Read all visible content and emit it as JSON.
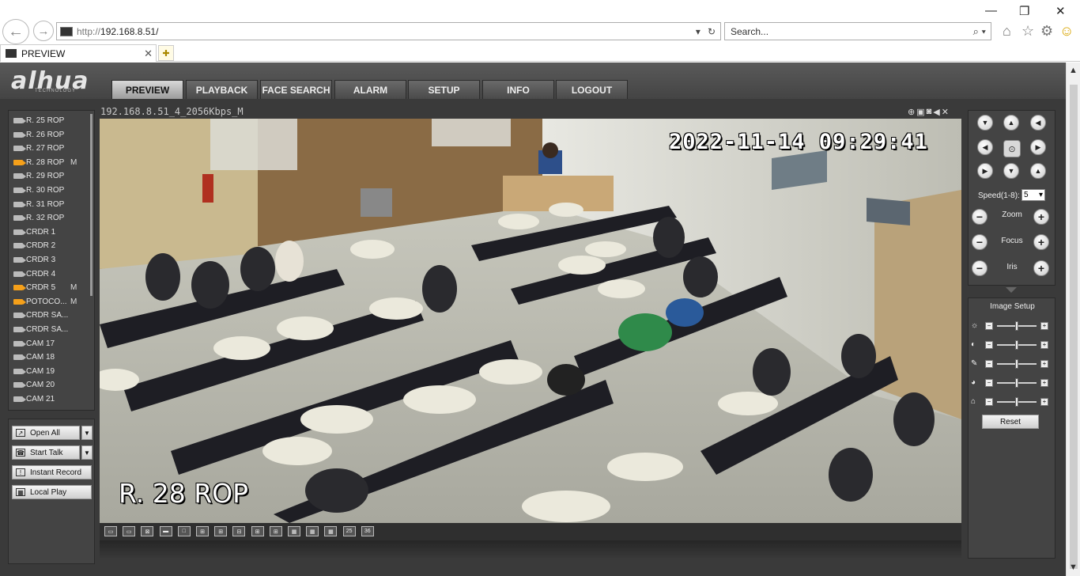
{
  "browser": {
    "url_proto": "http://",
    "url_host": "192.168.8.51/",
    "search_placeholder": "Search...",
    "tab_title": "PREVIEW"
  },
  "app": {
    "logo": "alhua",
    "logo_sub": "TECHNOLOGY",
    "menu": [
      "PREVIEW",
      "PLAYBACK",
      "FACE SEARCH",
      "ALARM",
      "SETUP",
      "INFO",
      "LOGOUT"
    ],
    "active_menu": "PREVIEW"
  },
  "cameras": [
    {
      "label": "R. 25 ROP",
      "active": false,
      "flag": ""
    },
    {
      "label": "R. 26 ROP",
      "active": false,
      "flag": ""
    },
    {
      "label": "R. 27 ROP",
      "active": false,
      "flag": ""
    },
    {
      "label": "R. 28 ROP",
      "active": true,
      "flag": "M"
    },
    {
      "label": "R. 29 ROP",
      "active": false,
      "flag": ""
    },
    {
      "label": "R. 30 ROP",
      "active": false,
      "flag": ""
    },
    {
      "label": "R. 31 ROP",
      "active": false,
      "flag": ""
    },
    {
      "label": "R. 32 ROP",
      "active": false,
      "flag": ""
    },
    {
      "label": "CRDR 1",
      "active": false,
      "flag": ""
    },
    {
      "label": "CRDR 2",
      "active": false,
      "flag": ""
    },
    {
      "label": "CRDR 3",
      "active": false,
      "flag": ""
    },
    {
      "label": "CRDR 4",
      "active": false,
      "flag": ""
    },
    {
      "label": "CRDR 5",
      "active": true,
      "flag": "M"
    },
    {
      "label": "POTOCO...",
      "active": true,
      "flag": "M"
    },
    {
      "label": "CRDR SA...",
      "active": false,
      "flag": ""
    },
    {
      "label": "CRDR SA...",
      "active": false,
      "flag": ""
    },
    {
      "label": "CAM 17",
      "active": false,
      "flag": ""
    },
    {
      "label": "CAM 18",
      "active": false,
      "flag": ""
    },
    {
      "label": "CAM 19",
      "active": false,
      "flag": ""
    },
    {
      "label": "CAM 20",
      "active": false,
      "flag": ""
    },
    {
      "label": "CAM 21",
      "active": false,
      "flag": ""
    }
  ],
  "actions": {
    "open_all": "Open All",
    "start_talk": "Start Talk",
    "instant_record": "Instant Record",
    "local_play": "Local Play"
  },
  "video": {
    "stream_title": "192.168.8.51_4_2056Kbps_M",
    "osd_time": "2022-11-14 09:29:41",
    "osd_name": "R. 28 ROP"
  },
  "layouts": [
    "",
    "",
    "",
    "",
    "",
    "",
    "",
    "",
    "",
    "",
    "",
    "",
    "",
    "25",
    "36"
  ],
  "ptz": {
    "speed_label": "Speed(1-8):",
    "speed_value": "5",
    "zoom": "Zoom",
    "focus": "Focus",
    "iris": "Iris"
  },
  "image_setup": {
    "title": "Image Setup",
    "reset": "Reset",
    "sliders": [
      0.5,
      0.5,
      0.5,
      0.5,
      0.5
    ]
  }
}
